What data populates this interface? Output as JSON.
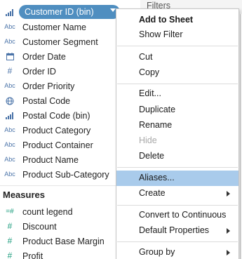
{
  "data_pane": {
    "selected_field": {
      "icon": "bin-icon",
      "label": "Customer ID (bin)"
    },
    "dimension_fields": [
      {
        "icon": "abc-icon",
        "icon_text": "Abc",
        "label": "Customer Name"
      },
      {
        "icon": "abc-icon",
        "icon_text": "Abc",
        "label": "Customer Segment"
      },
      {
        "icon": "calendar-icon",
        "icon_text": "",
        "label": "Order Date"
      },
      {
        "icon": "hash-icon",
        "icon_text": "#",
        "label": "Order ID"
      },
      {
        "icon": "abc-icon",
        "icon_text": "Abc",
        "label": "Order Priority"
      },
      {
        "icon": "globe-icon",
        "icon_text": "",
        "label": "Postal Code"
      },
      {
        "icon": "bin-icon",
        "icon_text": "",
        "label": "Postal Code (bin)"
      },
      {
        "icon": "abc-icon",
        "icon_text": "Abc",
        "label": "Product Category"
      },
      {
        "icon": "abc-icon",
        "icon_text": "Abc",
        "label": "Product Container"
      },
      {
        "icon": "abc-icon",
        "icon_text": "Abc",
        "label": "Product Name"
      },
      {
        "icon": "abc-icon",
        "icon_text": "Abc",
        "label": "Product Sub-Category"
      }
    ],
    "measures_header": "Measures",
    "measure_fields": [
      {
        "icon": "calculated-hash-icon",
        "icon_text": "=#",
        "label": "count legend"
      },
      {
        "icon": "hash-icon",
        "icon_text": "#",
        "label": "Discount"
      },
      {
        "icon": "hash-icon",
        "icon_text": "#",
        "label": "Product Base Margin"
      },
      {
        "icon": "hash-icon",
        "icon_text": "#",
        "label": "Profit"
      }
    ]
  },
  "filters_shelf": {
    "label": "Filters"
  },
  "context_menu": {
    "items": [
      {
        "label": "Add to Sheet",
        "bold": true
      },
      {
        "label": "Show Filter"
      },
      {
        "label": "Cut"
      },
      {
        "label": "Copy"
      },
      {
        "label": "Edit..."
      },
      {
        "label": "Duplicate"
      },
      {
        "label": "Rename"
      },
      {
        "label": "Hide",
        "disabled": true
      },
      {
        "label": "Delete"
      },
      {
        "label": "Aliases...",
        "highlighted": true
      },
      {
        "label": "Create",
        "submenu": true
      },
      {
        "label": "Convert to Continuous"
      },
      {
        "label": "Default Properties",
        "submenu": true
      },
      {
        "label": "Group by",
        "submenu": true
      }
    ]
  },
  "colors": {
    "pill": "#4f8ec0",
    "dimension_icon": "#4a73a8",
    "measure_icon": "#1b9c7d",
    "menu_highlight": "#a9cbeb"
  }
}
